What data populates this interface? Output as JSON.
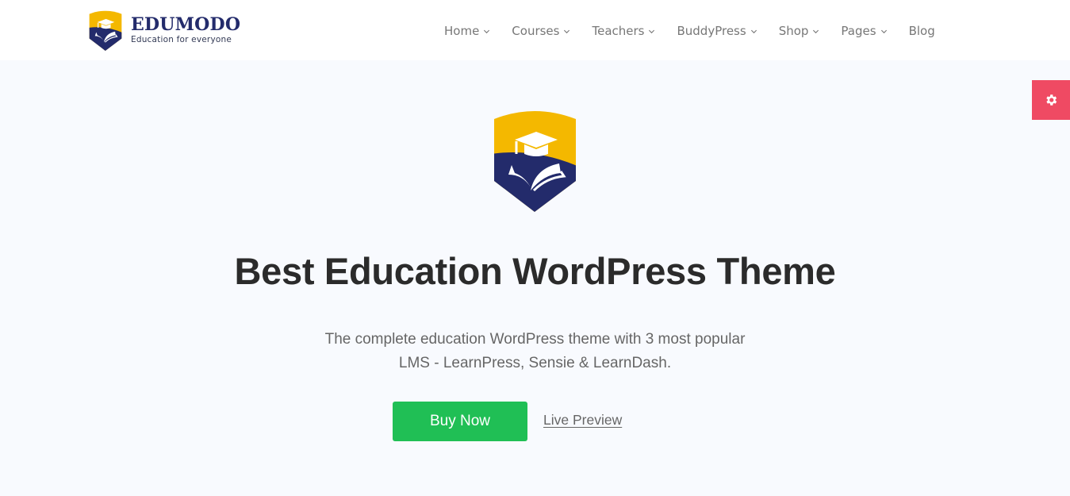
{
  "brand": {
    "name": "EDUMODO",
    "tagline": "Education for everyone",
    "colors": {
      "navy": "#232b6b",
      "gold": "#f4b800"
    }
  },
  "nav": {
    "items": [
      {
        "label": "Home",
        "has_dropdown": true
      },
      {
        "label": "Courses",
        "has_dropdown": true
      },
      {
        "label": "Teachers",
        "has_dropdown": true
      },
      {
        "label": "BuddyPress",
        "has_dropdown": true
      },
      {
        "label": "Shop",
        "has_dropdown": true
      },
      {
        "label": "Pages",
        "has_dropdown": true
      },
      {
        "label": "Blog",
        "has_dropdown": false
      }
    ]
  },
  "settings_tab": {
    "icon": "gear-icon",
    "color": "#ef4a63"
  },
  "hero": {
    "logo_icon": "shield-graduation-cap-book-icon",
    "title": "Best Education WordPress Theme",
    "subtitle_line1": "The complete education WordPress theme with 3 most popular",
    "subtitle_line2": "LMS - LearnPress, Sensie & LearnDash.",
    "buy_label": "Buy Now",
    "buy_color": "#20bf55",
    "preview_label": "Live Preview"
  }
}
